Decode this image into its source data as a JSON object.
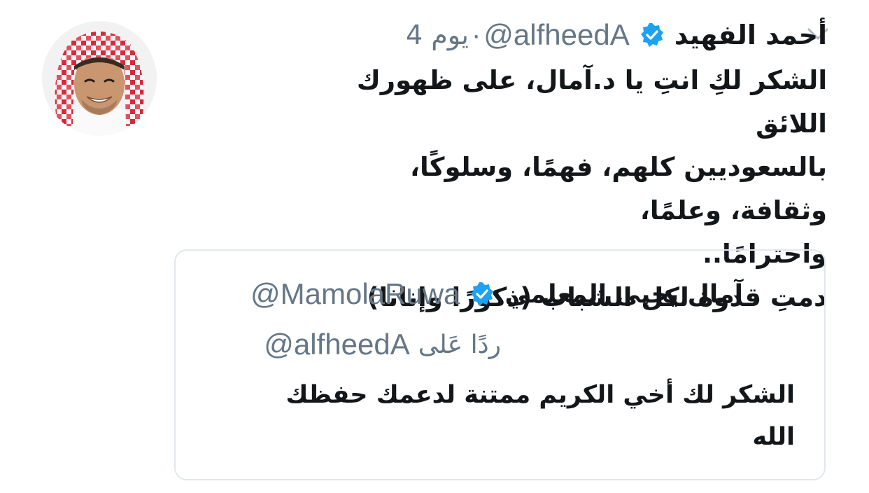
{
  "tweet": {
    "author_name": "أحمد الفهيد",
    "handle": "@alfheedA",
    "separator": "·",
    "time": "4 يوم",
    "text": [
      "الشكر لكِ انتِ يا د.آمال، على ظهورك اللائق",
      "بالسعوديين كلهم، فهمًا، وسلوكًا، وثقافة، وعلمًا،",
      "واحترامًا..",
      "دمتِ قدوة لكل الشباب (ذكورًا  وإناثا)"
    ]
  },
  "quoted_tweet": {
    "author_name": "آمال يحيى المعلمي",
    "handle": "@MamolaRuwa",
    "reply_label": "ردًا عَلى",
    "reply_handle": "@alfheedA",
    "text": "الشكر لك أخي الكريم ممتنة لدعمك حفظك الله"
  },
  "icons": {
    "menu": "chevron-down-icon",
    "verified": "verified-badge-icon",
    "avatar": "user-avatar"
  },
  "colors": {
    "primary_text": "#14171a",
    "secondary_text": "#657786",
    "verified_blue": "#1da1f2",
    "card_border": "#e1e8ed",
    "chevron": "#aab8c2"
  }
}
